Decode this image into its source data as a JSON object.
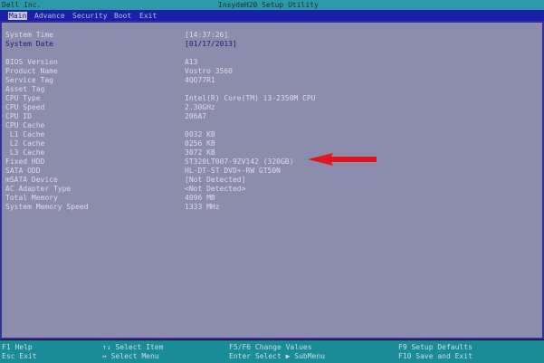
{
  "header": {
    "vendor": "Dell Inc.",
    "title": "InsydeH20 Setup Utility"
  },
  "menu": [
    {
      "label": "Main",
      "selected": true
    },
    {
      "label": "Advance"
    },
    {
      "label": "Security"
    },
    {
      "label": "Boot"
    },
    {
      "label": "Exit"
    }
  ],
  "rows": [
    {
      "label": "System Time",
      "value": "[14:37:26]"
    },
    {
      "label": "System Date",
      "value": "[01/17/2013]"
    },
    {
      "label": "BIOS Version",
      "value": "A13"
    },
    {
      "label": "Product Name",
      "value": "Vostro 3560"
    },
    {
      "label": "Service Tag",
      "value": "4QQ77R1"
    },
    {
      "label": "Asset Tag",
      "value": ""
    },
    {
      "label": "CPU Type",
      "value": "Intel(R) Core(TM) i3-2350M CPU"
    },
    {
      "label": "CPU Speed",
      "value": "2.30GHz"
    },
    {
      "label": "CPU ID",
      "value": "206A7"
    },
    {
      "label": "CPU Cache",
      "value": ""
    },
    {
      "label": " L1 Cache",
      "value": "0032 KB"
    },
    {
      "label": " L2 Cache",
      "value": "0256 KB"
    },
    {
      "label": " L3 Cache",
      "value": "3072 KB"
    },
    {
      "label": "Fixed HDD",
      "value": "ST320LT007-9ZV142  (320GB)"
    },
    {
      "label": "SATA ODD",
      "value": "HL-DT-ST DVD+-RW GT50N"
    },
    {
      "label": "mSATA Device",
      "value": "[Not Detected]"
    },
    {
      "label": "AC Adapter Type",
      "value": "<Not Detected>"
    },
    {
      "label": "Total Memory",
      "value": "4096 MB"
    },
    {
      "label": "System Memory Speed",
      "value": "1333 MHz"
    }
  ],
  "footer": {
    "f1": "F1  Help",
    "esc": "Esc Exit",
    "select_item": "↑↓ Select Item",
    "select_menu": "↔ Select Menu",
    "change": "F5/F6 Change Values",
    "enter": "Enter Select ▶ SubMenu",
    "f9": "F9  Setup Defaults",
    "f10": "F10 Save and Exit"
  },
  "colors": {
    "arrow": "#e0161e"
  }
}
